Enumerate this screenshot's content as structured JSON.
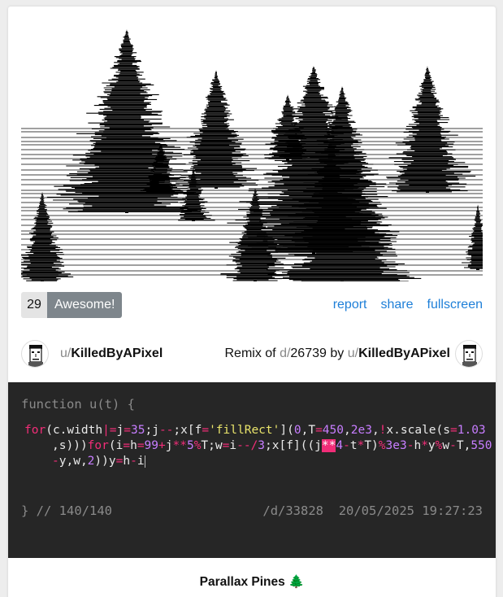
{
  "post": {
    "vote_count": "29",
    "awesome_label": "Awesome!",
    "links": {
      "report": "report",
      "share": "share",
      "fullscreen": "fullscreen"
    },
    "author": {
      "prefix": "u/",
      "name": "KilledByAPixel"
    },
    "remix": {
      "label": "Remix of",
      "d_prefix": "d/",
      "dweet_id": "26739",
      "by_label": "by",
      "u_prefix": "u/",
      "original_author": "KilledByAPixel"
    },
    "title": "Parallax Pines 🌲"
  },
  "code": {
    "header": "function u(t) {",
    "lines": [
      "for(c.width|=j=35;j--;x[f='fillRect'](0,T=450,2e3,!x.scale(s=1.03",
      ",s)))for(i=h=99+j**5%T;w=i--/3;x[f]((j**4-t*T)%3e3-h*y%w-T,550",
      "-y,w,2))y=h-i"
    ],
    "footer": "} // 140/140",
    "dweet_path": "/d/33828",
    "timestamp": "20/05/2025 19:27:23"
  },
  "colors": {
    "keyword": "#f22d78",
    "number": "#c77dff",
    "string": "#e9e46b",
    "link": "#1e7fd8",
    "button": "#7e868c",
    "code_bg": "#262626"
  }
}
